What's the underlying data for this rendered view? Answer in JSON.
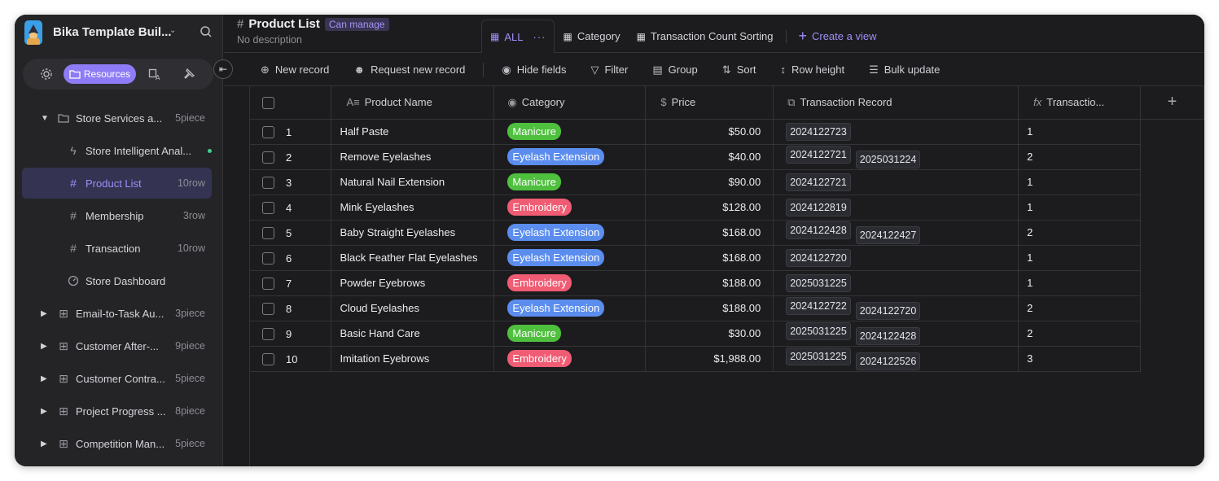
{
  "sidebar": {
    "title": "Bika Template Buil...",
    "tabs": {
      "resources": "Resources"
    },
    "items": [
      {
        "label": "Store Services a...",
        "count": "5piece"
      },
      {
        "label": "Store Intelligent Anal..."
      },
      {
        "label": "Product List",
        "count": "10row"
      },
      {
        "label": "Membership",
        "count": "3row"
      },
      {
        "label": "Transaction",
        "count": "10row"
      },
      {
        "label": "Store Dashboard"
      },
      {
        "label": "Email-to-Task Au...",
        "count": "3piece"
      },
      {
        "label": "Customer After-...",
        "count": "9piece"
      },
      {
        "label": "Customer Contra...",
        "count": "5piece"
      },
      {
        "label": "Project Progress ...",
        "count": "8piece"
      },
      {
        "label": "Competition Man...",
        "count": "5piece"
      }
    ]
  },
  "header": {
    "title": "Product List",
    "permission": "Can manage",
    "description": "No description",
    "views": [
      "ALL",
      "Category",
      "Transaction Count Sorting"
    ],
    "create_view": "Create a view"
  },
  "toolbar": {
    "new_record": "New record",
    "request_new_record": "Request new record",
    "hide_fields": "Hide fields",
    "filter": "Filter",
    "group": "Group",
    "sort": "Sort",
    "row_height": "Row height",
    "bulk_update": "Bulk update"
  },
  "table": {
    "columns": [
      "Product Name",
      "Category",
      "Price",
      "Transaction Record",
      "Transactio..."
    ],
    "category_colors": {
      "Manicure": "#4fbf3e",
      "Eyelash Extension": "#5b8def",
      "Embroidery": "#f05c73"
    },
    "rows": [
      {
        "n": "1",
        "name": "Half Paste",
        "category": "Manicure",
        "price": "$50.00",
        "records": [
          "2024122723"
        ],
        "count": "1"
      },
      {
        "n": "2",
        "name": "Remove Eyelashes",
        "category": "Eyelash Extension",
        "price": "$40.00",
        "records": [
          "2024122721",
          "2025031224"
        ],
        "count": "2"
      },
      {
        "n": "3",
        "name": "Natural Nail Extension",
        "category": "Manicure",
        "price": "$90.00",
        "records": [
          "2024122721"
        ],
        "count": "1"
      },
      {
        "n": "4",
        "name": "Mink Eyelashes",
        "category": "Embroidery",
        "price": "$128.00",
        "records": [
          "2024122819"
        ],
        "count": "1"
      },
      {
        "n": "5",
        "name": "Baby Straight Eyelashes",
        "category": "Eyelash Extension",
        "price": "$168.00",
        "records": [
          "2024122428",
          "2024122427"
        ],
        "count": "2"
      },
      {
        "n": "6",
        "name": "Black Feather Flat Eyelashes",
        "category": "Eyelash Extension",
        "price": "$168.00",
        "records": [
          "2024122720"
        ],
        "count": "1"
      },
      {
        "n": "7",
        "name": "Powder Eyebrows",
        "category": "Embroidery",
        "price": "$188.00",
        "records": [
          "2025031225"
        ],
        "count": "1"
      },
      {
        "n": "8",
        "name": "Cloud Eyelashes",
        "category": "Eyelash Extension",
        "price": "$188.00",
        "records": [
          "2024122722",
          "2024122720"
        ],
        "count": "2"
      },
      {
        "n": "9",
        "name": "Basic Hand Care",
        "category": "Manicure",
        "price": "$30.00",
        "records": [
          "2025031225",
          "2024122428"
        ],
        "count": "2"
      },
      {
        "n": "10",
        "name": "Imitation Eyebrows",
        "category": "Embroidery",
        "price": "$1,988.00",
        "records": [
          "2025031225",
          "2024122526"
        ],
        "count": "3"
      }
    ]
  }
}
